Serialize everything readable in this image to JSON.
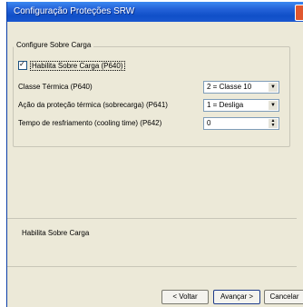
{
  "window": {
    "title": "Configuração Proteções SRW"
  },
  "group": {
    "legend": "Configure Sobre Carga",
    "checkbox_label": "Habilita Sobre Carga (P640)",
    "checkbox_checked": true,
    "fields": [
      {
        "label": "Classe Térmica (P640)",
        "value": "2 = Classe 10",
        "control": "select"
      },
      {
        "label": "Ação da proteção térmica (sobrecarga) (P641)",
        "value": "1 = Desliga",
        "control": "select"
      },
      {
        "label": "Tempo de resfriamento (cooling time) (P642)",
        "value": "0",
        "control": "spin"
      }
    ]
  },
  "description": {
    "text": "Habilita Sobre Carga"
  },
  "buttons": {
    "back": "< Voltar",
    "next": "Avançar >",
    "cancel": "Cancelar"
  }
}
